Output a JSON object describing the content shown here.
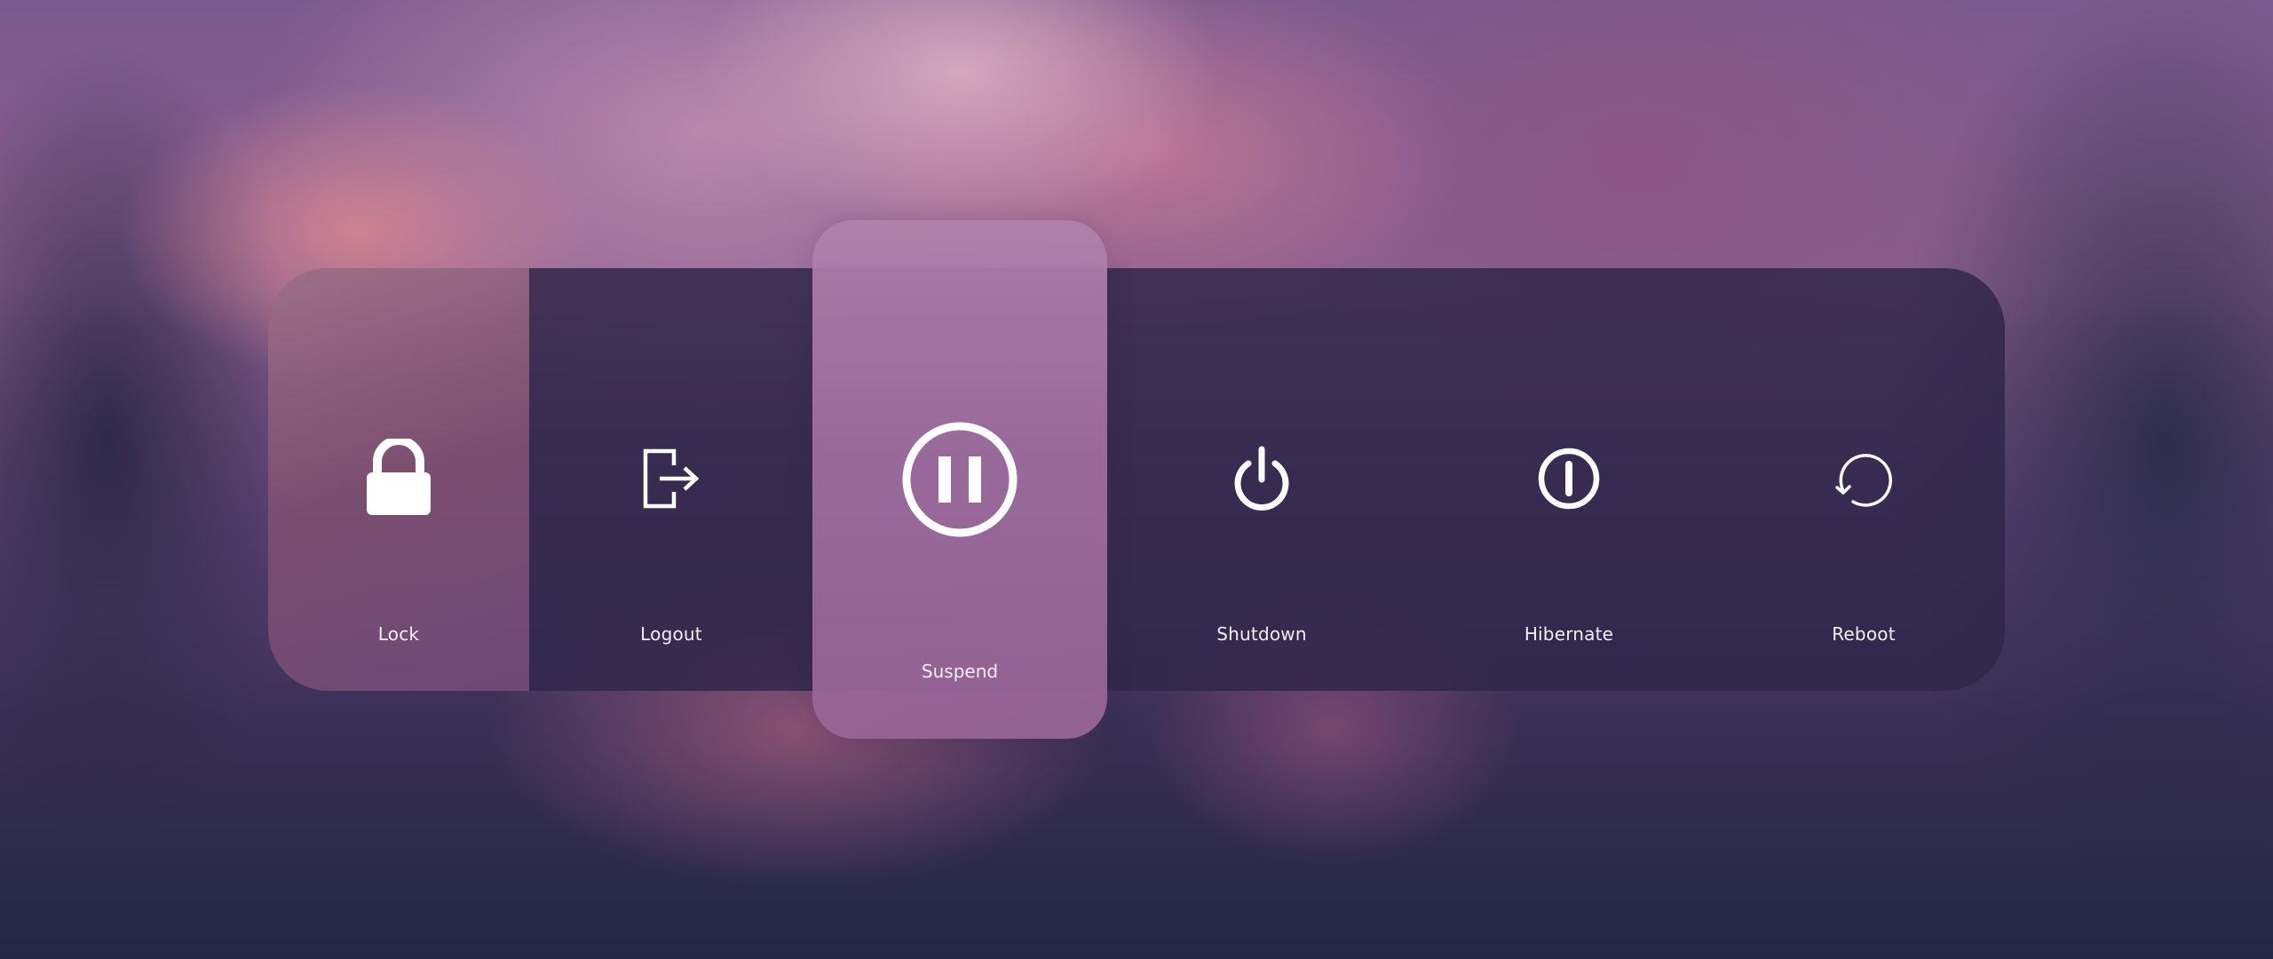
{
  "power_menu": {
    "items": [
      {
        "id": "lock",
        "label": "Lock",
        "icon": "lock-icon"
      },
      {
        "id": "logout",
        "label": "Logout",
        "icon": "logout-icon"
      },
      {
        "id": "suspend",
        "label": "Suspend",
        "icon": "pause-circle-icon",
        "selected": true
      },
      {
        "id": "shutdown",
        "label": "Shutdown",
        "icon": "power-icon"
      },
      {
        "id": "hibernate",
        "label": "Hibernate",
        "icon": "hibernate-icon"
      },
      {
        "id": "reboot",
        "label": "Reboot",
        "icon": "reboot-icon"
      }
    ]
  },
  "colors": {
    "panel": "#30264a",
    "selected": "#a06ea0",
    "lock_tint": "#d98ea6",
    "text": "#ffffff"
  }
}
